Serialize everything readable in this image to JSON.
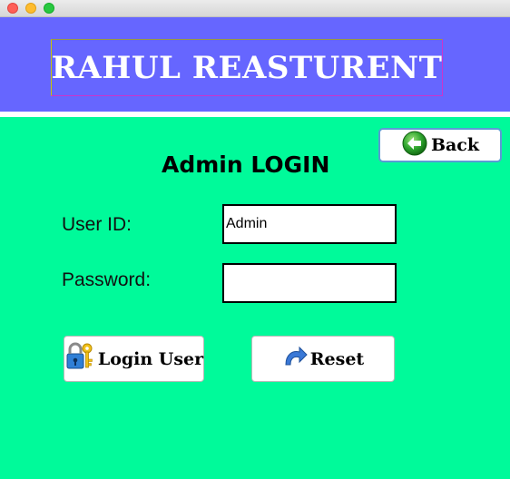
{
  "window": {
    "controls": [
      "close",
      "minimize",
      "maximize"
    ]
  },
  "header": {
    "title": "RAHUL REASTURENT",
    "background": "#6666ff"
  },
  "panel": {
    "background": "#00fa9a",
    "heading": "Admin LOGIN"
  },
  "back_button": {
    "label": "Back",
    "icon": "back-arrow-icon"
  },
  "form": {
    "userid_label": "User ID:",
    "userid_value": "Admin",
    "password_label": "Password:",
    "password_value": ""
  },
  "login_button": {
    "label": "Login User",
    "icon": "key-lock-icon"
  },
  "reset_button": {
    "label": "Reset",
    "icon": "reset-arrow-icon"
  }
}
